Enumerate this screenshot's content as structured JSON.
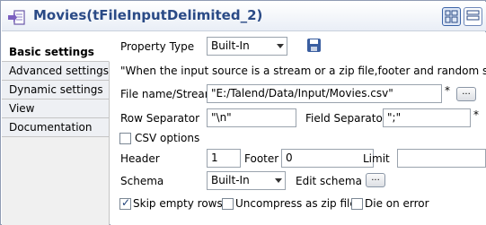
{
  "window": {
    "title": "Movies(tFileInputDelimited_2)"
  },
  "tabs": [
    "Basic settings",
    "Advanced settings",
    "Dynamic settings",
    "View",
    "Documentation"
  ],
  "property_type": {
    "label": "Property Type",
    "value": "Built-In"
  },
  "notice": "\"When the input source is a stream or a zip file,footer and random shouldn't b",
  "file": {
    "label": "File name/Stream",
    "value": "\"E:/Talend/Data/Input/Movies.csv\"",
    "required": "*",
    "browse": "..."
  },
  "row_separator": {
    "label": "Row Separator",
    "value": "\"\\n\""
  },
  "field_separator": {
    "label": "Field Separator",
    "value": "\";\"",
    "required": "*"
  },
  "csv_options": {
    "label": "CSV options",
    "checked": false
  },
  "header": {
    "label": "Header",
    "value": "1"
  },
  "footer": {
    "label": "Footer",
    "value": "0"
  },
  "limit": {
    "label": "Limit",
    "value": ""
  },
  "schema": {
    "label": "Schema",
    "value": "Built-In",
    "edit_label": "Edit schema",
    "edit_button": "..."
  },
  "options": {
    "skip_empty_rows": {
      "label": "Skip empty rows",
      "checked": true
    },
    "uncompress_zip": {
      "label": "Uncompress as zip file",
      "checked": false
    },
    "die_on_error": {
      "label": "Die on error",
      "checked": false
    }
  },
  "colors": {
    "title": "#2a4a86",
    "accent": "#3a62a6"
  }
}
